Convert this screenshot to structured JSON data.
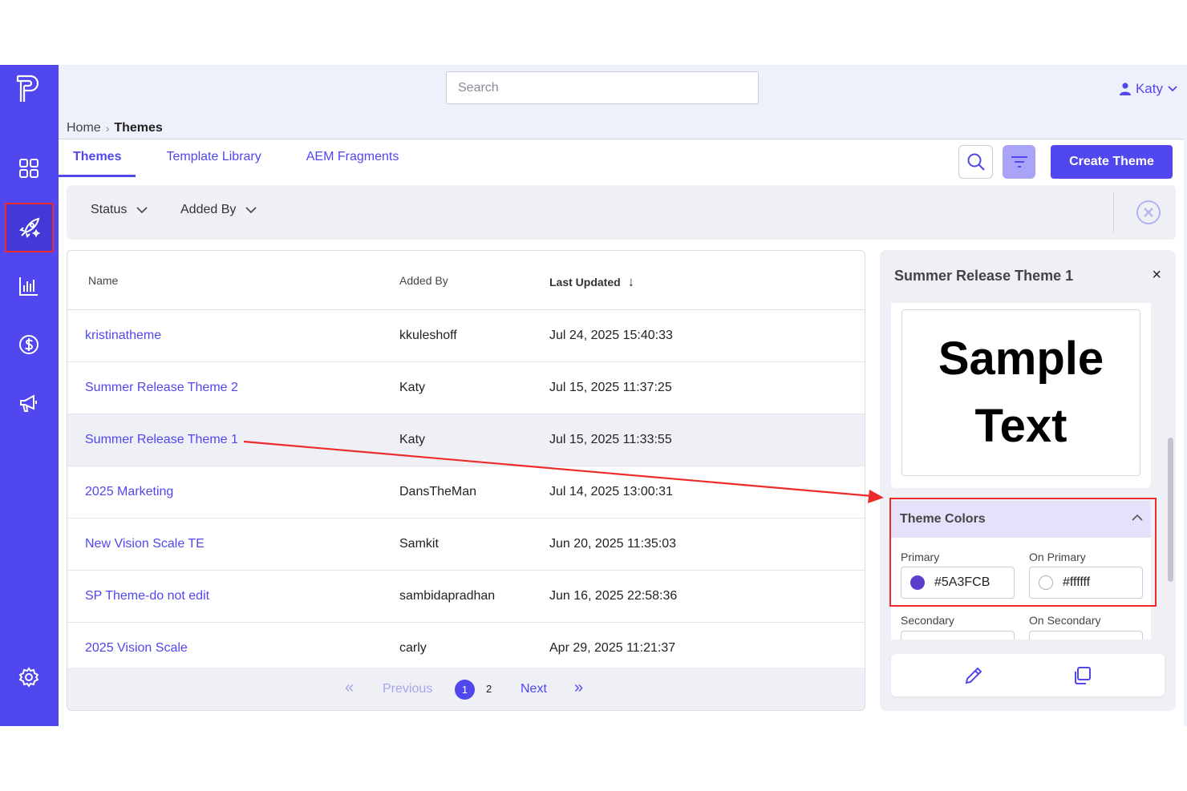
{
  "header": {
    "search_placeholder": "Search",
    "user_name": "Katy"
  },
  "breadcrumb": {
    "home": "Home",
    "separator": "›",
    "current": "Themes"
  },
  "tabs": [
    {
      "label": "Themes",
      "active": true
    },
    {
      "label": "Template Library",
      "active": false
    },
    {
      "label": "AEM Fragments",
      "active": false
    }
  ],
  "toolbar": {
    "create_label": "Create Theme"
  },
  "filters": {
    "status_label": "Status",
    "added_by_label": "Added By"
  },
  "table": {
    "columns": [
      "Name",
      "Added By",
      "Last Updated"
    ],
    "sort_indicator": "↓",
    "rows": [
      {
        "name": "kristinatheme",
        "added_by": "kkuleshoff",
        "updated": "Jul 24, 2025 15:40:33"
      },
      {
        "name": "Summer Release Theme 2",
        "added_by": "Katy",
        "updated": "Jul 15, 2025 11:37:25"
      },
      {
        "name": "Summer Release Theme 1",
        "added_by": "Katy",
        "updated": "Jul 15, 2025 11:33:55"
      },
      {
        "name": "2025 Marketing",
        "added_by": "DansTheMan",
        "updated": "Jul 14, 2025 13:00:31"
      },
      {
        "name": "New Vision Scale TE",
        "added_by": "Samkit",
        "updated": "Jun 20, 2025 11:35:03"
      },
      {
        "name": "SP Theme-do not edit",
        "added_by": "sambidapradhan",
        "updated": "Jun 16, 2025 22:58:36"
      },
      {
        "name": "2025 Vision Scale",
        "added_by": "carly",
        "updated": "Apr 29, 2025 11:21:37"
      }
    ]
  },
  "pagination": {
    "first": "«",
    "previous": "Previous",
    "page1": "1",
    "page2": "2",
    "next": "Next",
    "last": "»"
  },
  "panel": {
    "title": "Summer Release Theme 1",
    "close": "×",
    "sample_line1": "Sample",
    "sample_line2": "Text",
    "colors_heading": "Theme Colors",
    "primary_label": "Primary",
    "primary_value": "#5A3FCB",
    "on_primary_label": "On Primary",
    "on_primary_value": "#ffffff",
    "secondary_label": "Secondary",
    "on_secondary_label": "On Secondary"
  },
  "colors": {
    "accent": "#5147ee",
    "primary_swatch": "#5A3FCB",
    "on_primary_swatch": "#ffffff",
    "highlight": "#ee2b2b"
  }
}
